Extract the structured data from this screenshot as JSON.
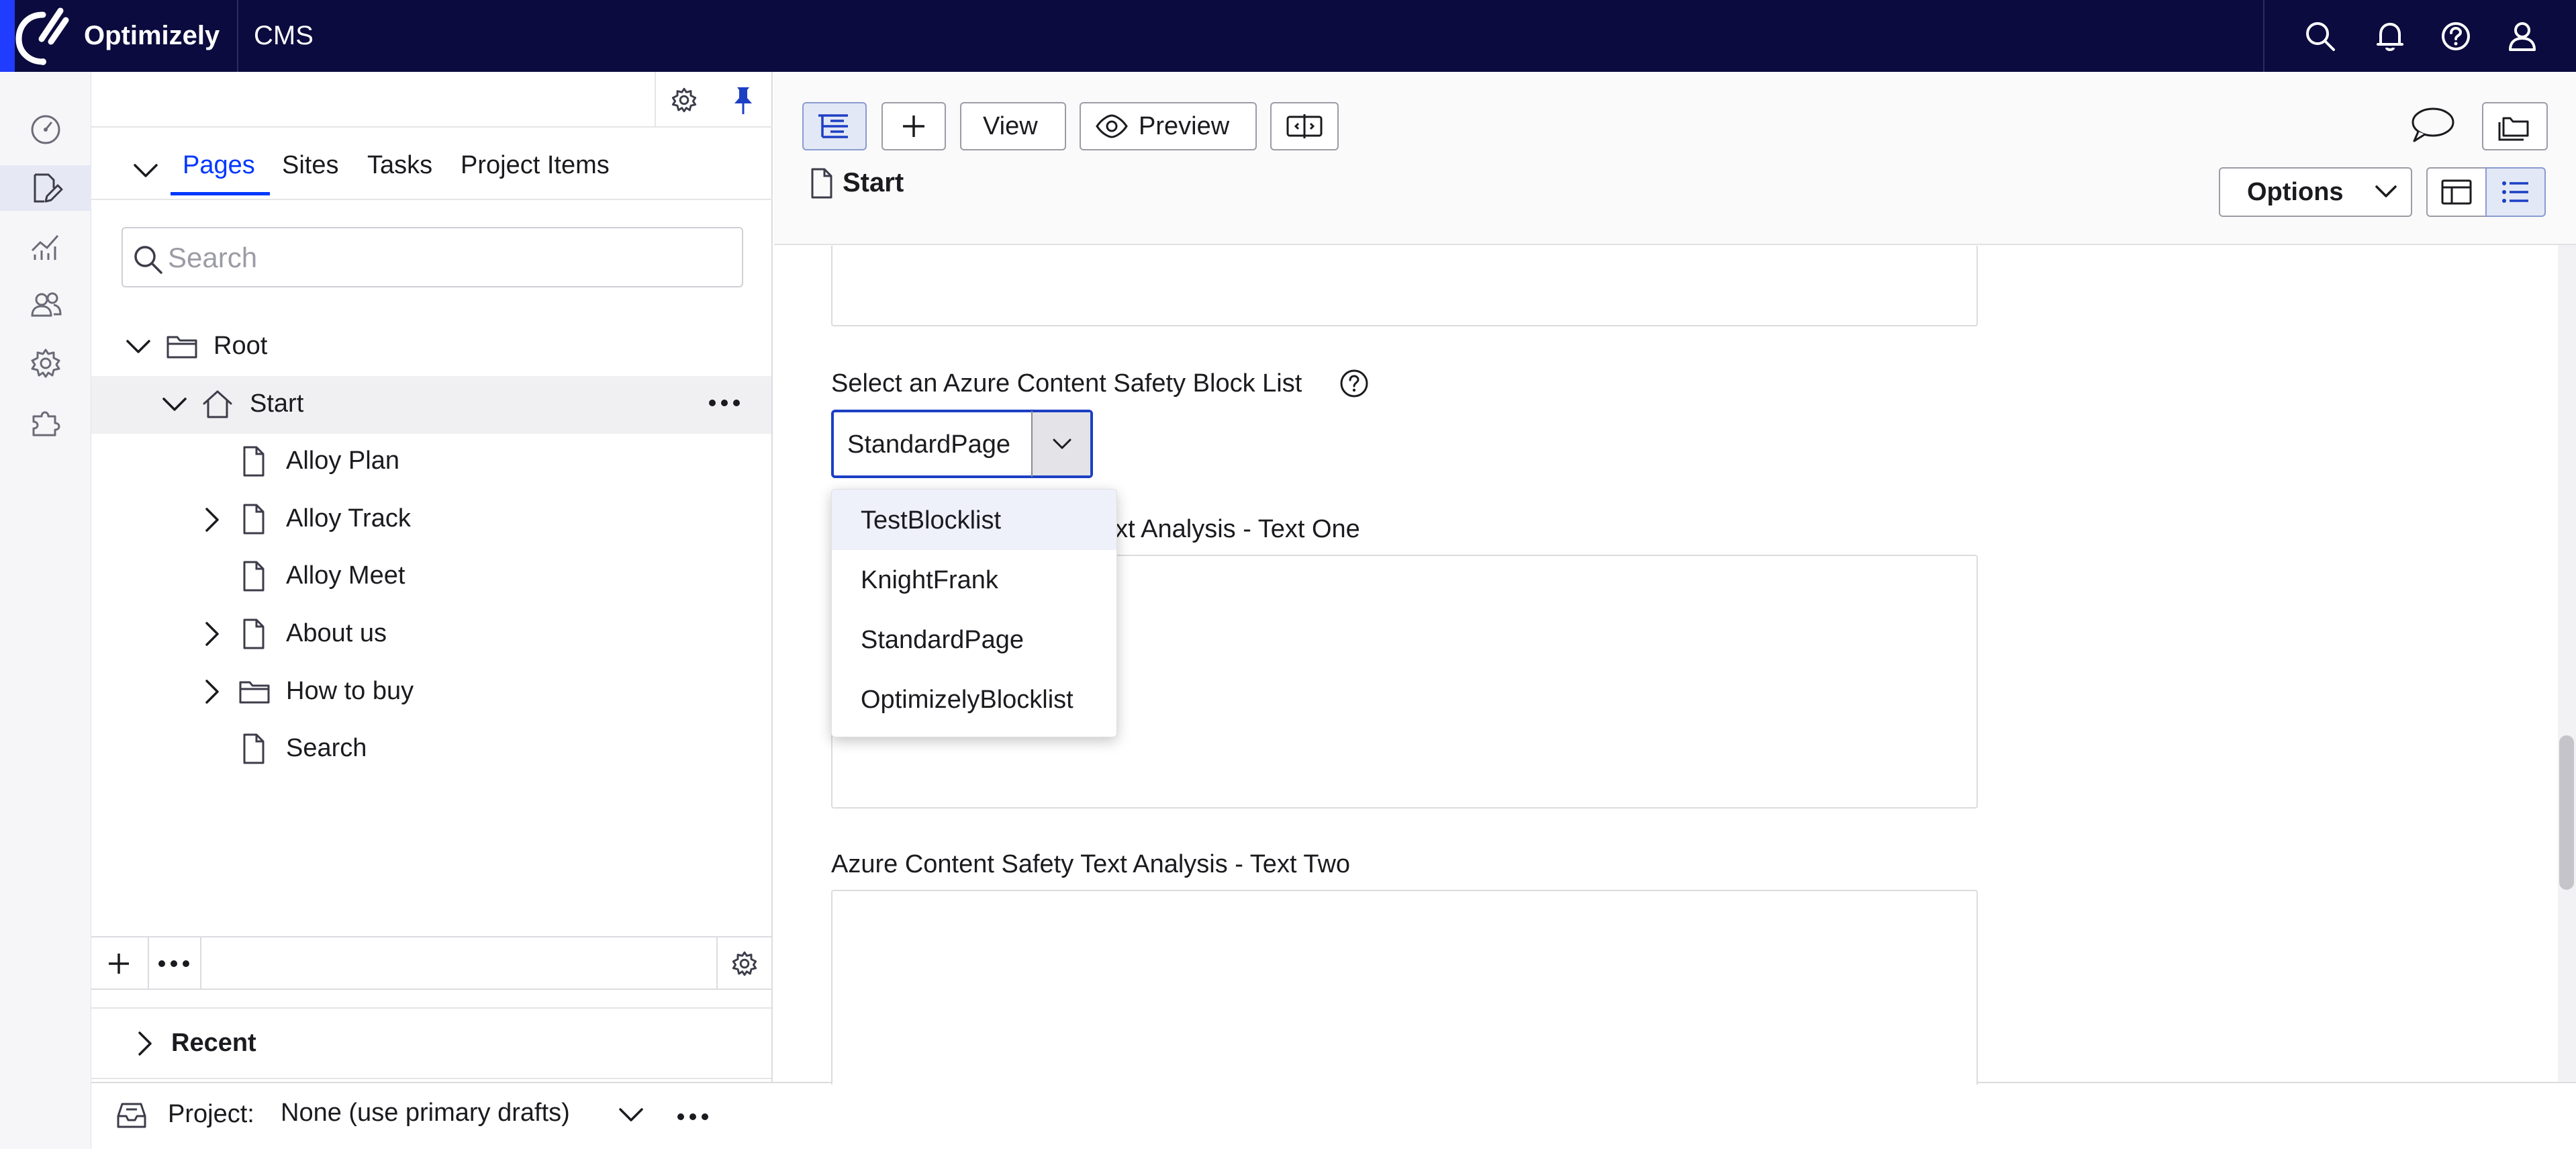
{
  "topbar": {
    "brand": "Optimizely",
    "product": "CMS",
    "icons": [
      "search-icon",
      "bell-icon",
      "help-icon",
      "user-icon"
    ]
  },
  "rail": {
    "icons": [
      "dashboard-icon",
      "edit-icon",
      "analytics-icon",
      "users-icon",
      "settings-icon",
      "addons-icon"
    ]
  },
  "nav": {
    "tabs": [
      {
        "label": "Pages"
      },
      {
        "label": "Sites"
      },
      {
        "label": "Tasks"
      },
      {
        "label": "Project Items"
      }
    ],
    "search_placeholder": "Search",
    "tree": {
      "root": "Root",
      "start": "Start",
      "children": [
        "Alloy Plan",
        "Alloy Track",
        "Alloy Meet",
        "About us",
        "How to buy",
        "Search"
      ]
    },
    "recent": "Recent"
  },
  "project": {
    "label": "Project:",
    "value": "None (use primary drafts)"
  },
  "content": {
    "toolbar": {
      "view_label": "View",
      "preview_label": "Preview"
    },
    "page_title": "Start",
    "options_label": "Options",
    "blocklist_label": "Select an Azure Content Safety Block List",
    "blocklist_selected": "StandardPage",
    "blocklist_options": [
      "TestBlocklist",
      "KnightFrank",
      "StandardPage",
      "OptimizelyBlocklist"
    ],
    "text_one_label_visible": "ext Analysis - Text One",
    "text_two_label": "Azure Content Safety Text Analysis - Text Two"
  },
  "colors": {
    "topbar": "#0b0b3f",
    "accent": "#0037ff",
    "focus": "#1c3fc4"
  }
}
